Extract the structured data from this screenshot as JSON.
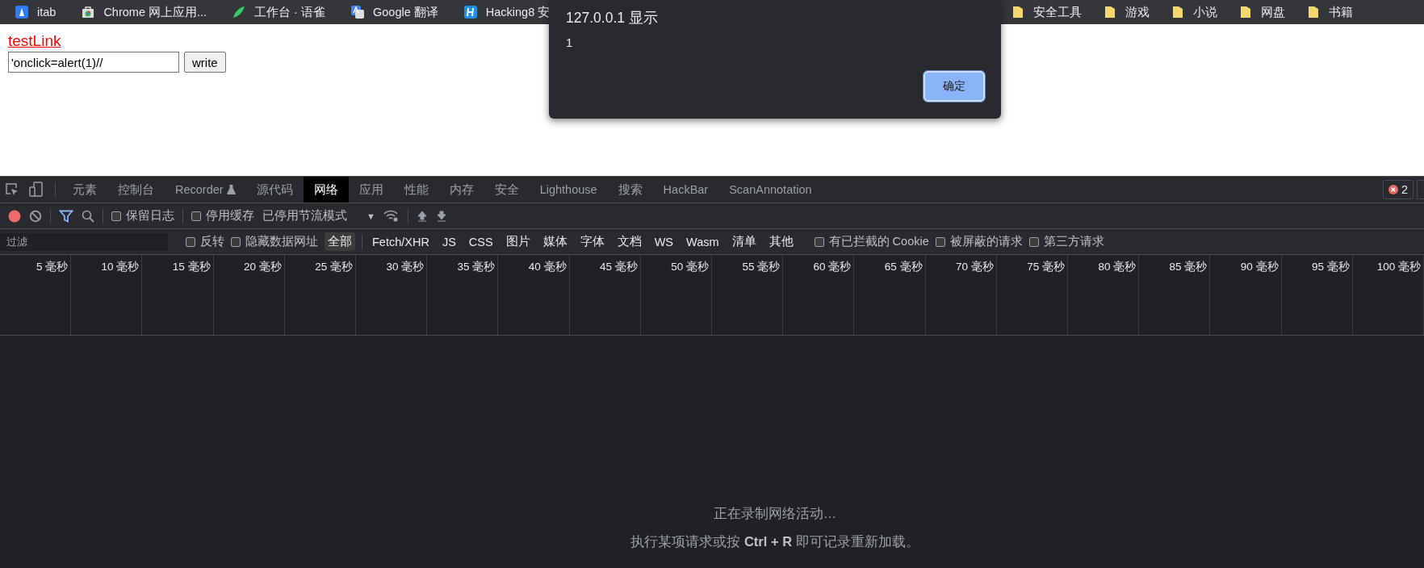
{
  "bookmarks": [
    {
      "label": "itab"
    },
    {
      "label": "Chrome 网上应用..."
    },
    {
      "label": "工作台 · 语雀"
    },
    {
      "label": "Google 翻译"
    },
    {
      "label": "Hacking8 安"
    }
  ],
  "bookmark_folders": [
    {
      "label": "安全工具"
    },
    {
      "label": "游戏"
    },
    {
      "label": "小说"
    },
    {
      "label": "网盘"
    },
    {
      "label": "书籍"
    }
  ],
  "page": {
    "link": "testLink",
    "input_value": "'onclick=alert(1)//",
    "button": "write"
  },
  "dialog": {
    "title": "127.0.0.1 显示",
    "message": "1",
    "button": "确定"
  },
  "devtools": {
    "tabs": [
      {
        "label": "元素",
        "selected": false,
        "kind": "plain"
      },
      {
        "label": "控制台",
        "selected": false,
        "kind": "plain"
      },
      {
        "label": "Recorder",
        "selected": false,
        "kind": "experimental"
      },
      {
        "label": "源代码",
        "selected": false,
        "kind": "plain"
      },
      {
        "label": "网络",
        "selected": true,
        "kind": "plain"
      },
      {
        "label": "应用",
        "selected": false,
        "kind": "plain"
      },
      {
        "label": "性能",
        "selected": false,
        "kind": "plain"
      },
      {
        "label": "内存",
        "selected": false,
        "kind": "plain"
      },
      {
        "label": "安全",
        "selected": false,
        "kind": "plain"
      },
      {
        "label": "Lighthouse",
        "selected": false,
        "kind": "plain"
      },
      {
        "label": "搜索",
        "selected": false,
        "kind": "plain"
      },
      {
        "label": "HackBar",
        "selected": false,
        "kind": "plain"
      },
      {
        "label": "ScanAnnotation",
        "selected": false,
        "kind": "plain"
      }
    ],
    "error_count": "2",
    "toolbar": {
      "options": [
        {
          "label": "保留日志",
          "checked": false
        },
        {
          "label": "停用缓存",
          "checked": false
        }
      ],
      "throttling": "已停用节流模式",
      "throttling_caret": "▼"
    },
    "filter": {
      "placeholder": "过滤",
      "options": [
        {
          "label": "反转",
          "checked": false
        },
        {
          "label": "隐藏数据网址",
          "checked": false
        }
      ],
      "types": [
        {
          "label": "全部",
          "selected": true
        },
        {
          "label": "Fetch/XHR",
          "selected": false
        },
        {
          "label": "JS",
          "selected": false
        },
        {
          "label": "CSS",
          "selected": false
        },
        {
          "label": "图片",
          "selected": false
        },
        {
          "label": "媒体",
          "selected": false
        },
        {
          "label": "字体",
          "selected": false
        },
        {
          "label": "文档",
          "selected": false
        },
        {
          "label": "WS",
          "selected": false
        },
        {
          "label": "Wasm",
          "selected": false
        },
        {
          "label": "清单",
          "selected": false
        },
        {
          "label": "其他",
          "selected": false
        }
      ],
      "extra_options": [
        {
          "label": "有已拦截的 Cookie",
          "checked": false
        },
        {
          "label": "被屏蔽的请求",
          "checked": false
        },
        {
          "label": "第三方请求",
          "checked": false
        }
      ]
    },
    "timeline_ticks": [
      "5 毫秒",
      "10 毫秒",
      "15 毫秒",
      "20 毫秒",
      "25 毫秒",
      "30 毫秒",
      "35 毫秒",
      "40 毫秒",
      "45 毫秒",
      "50 毫秒",
      "55 毫秒",
      "60 毫秒",
      "65 毫秒",
      "70 毫秒",
      "75 毫秒",
      "80 毫秒",
      "85 毫秒",
      "90 毫秒",
      "95 毫秒",
      "100 毫秒"
    ],
    "empty_state": {
      "title": "正在录制网络活动…",
      "hint": "执行某项请求或按 **Ctrl + R** 即可记录重新加载。"
    }
  }
}
